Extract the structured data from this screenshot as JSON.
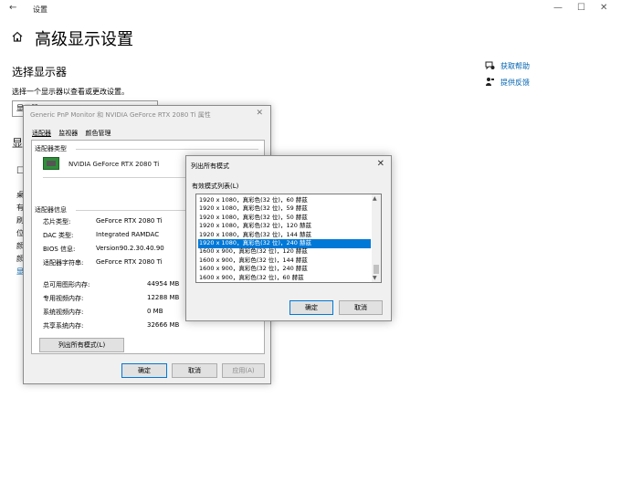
{
  "settings": {
    "app_title": "设置",
    "back_icon": "←",
    "win_min": "—",
    "win_max": "☐",
    "win_close": "✕",
    "page_title": "高级显示设置",
    "section_title": "选择显示器",
    "section_desc": "选择一个显示器以查看或更改设置。",
    "display_select_value": "显示器 1: IWO5OH1Q)",
    "hidden_fragments": [
      "显示",
      "☐",
      "桌",
      "有",
      "刷",
      "位",
      "颜",
      "颜",
      "显"
    ],
    "help_links": [
      "获取帮助",
      "提供反馈"
    ]
  },
  "properties_dialog": {
    "title": "Generic PnP Monitor 和 NVIDIA GeForce RTX 2080 Ti 属性",
    "close": "✕",
    "tabs": [
      "适配器",
      "监视器",
      "颜色管理"
    ],
    "adapter_type_label": "适配器类型",
    "adapter_name": "NVIDIA GeForce RTX 2080 Ti",
    "adapter_info_label": "适配器信息",
    "info": [
      {
        "k": "芯片类型:",
        "v": "GeForce RTX 2080 Ti"
      },
      {
        "k": "DAC 类型:",
        "v": "Integrated RAMDAC"
      },
      {
        "k": "BIOS 信息:",
        "v": "Version90.2.30.40.90"
      },
      {
        "k": "适配器字符串:",
        "v": "GeForce RTX 2080 Ti"
      }
    ],
    "memory": [
      {
        "k": "总可用图形内存:",
        "v": "44954 MB"
      },
      {
        "k": "专用视频内存:",
        "v": "12288 MB"
      },
      {
        "k": "系统视频内存:",
        "v": "0 MB"
      },
      {
        "k": "共享系统内存:",
        "v": "32666 MB"
      }
    ],
    "list_modes_button": "列出所有模式(L)",
    "ok": "确定",
    "cancel": "取消",
    "apply": "应用(A)"
  },
  "modes_dialog": {
    "title": "列出所有模式",
    "close": "✕",
    "group_label": "有效模式列表(L)",
    "items": [
      "1920 x 1080，真彩色(32 位)，60 赫兹",
      "1920 x 1080，真彩色(32 位)，59 赫兹",
      "1920 x 1080，真彩色(32 位)，50 赫兹",
      "1920 x 1080，真彩色(32 位)，120 赫兹",
      "1920 x 1080，真彩色(32 位)，144 赫兹",
      "1920 x 1080，真彩色(32 位)，240 赫兹",
      "1600 x 900，真彩色(32 位)，120 赫兹",
      "1600 x 900，真彩色(32 位)，144 赫兹",
      "1600 x 900，真彩色(32 位)，240 赫兹",
      "1600 x 900，真彩色(32 位)，60 赫兹"
    ],
    "selected_index": 5,
    "scroll_up": "▲",
    "scroll_down": "▼",
    "ok": "确定",
    "cancel": "取消"
  }
}
